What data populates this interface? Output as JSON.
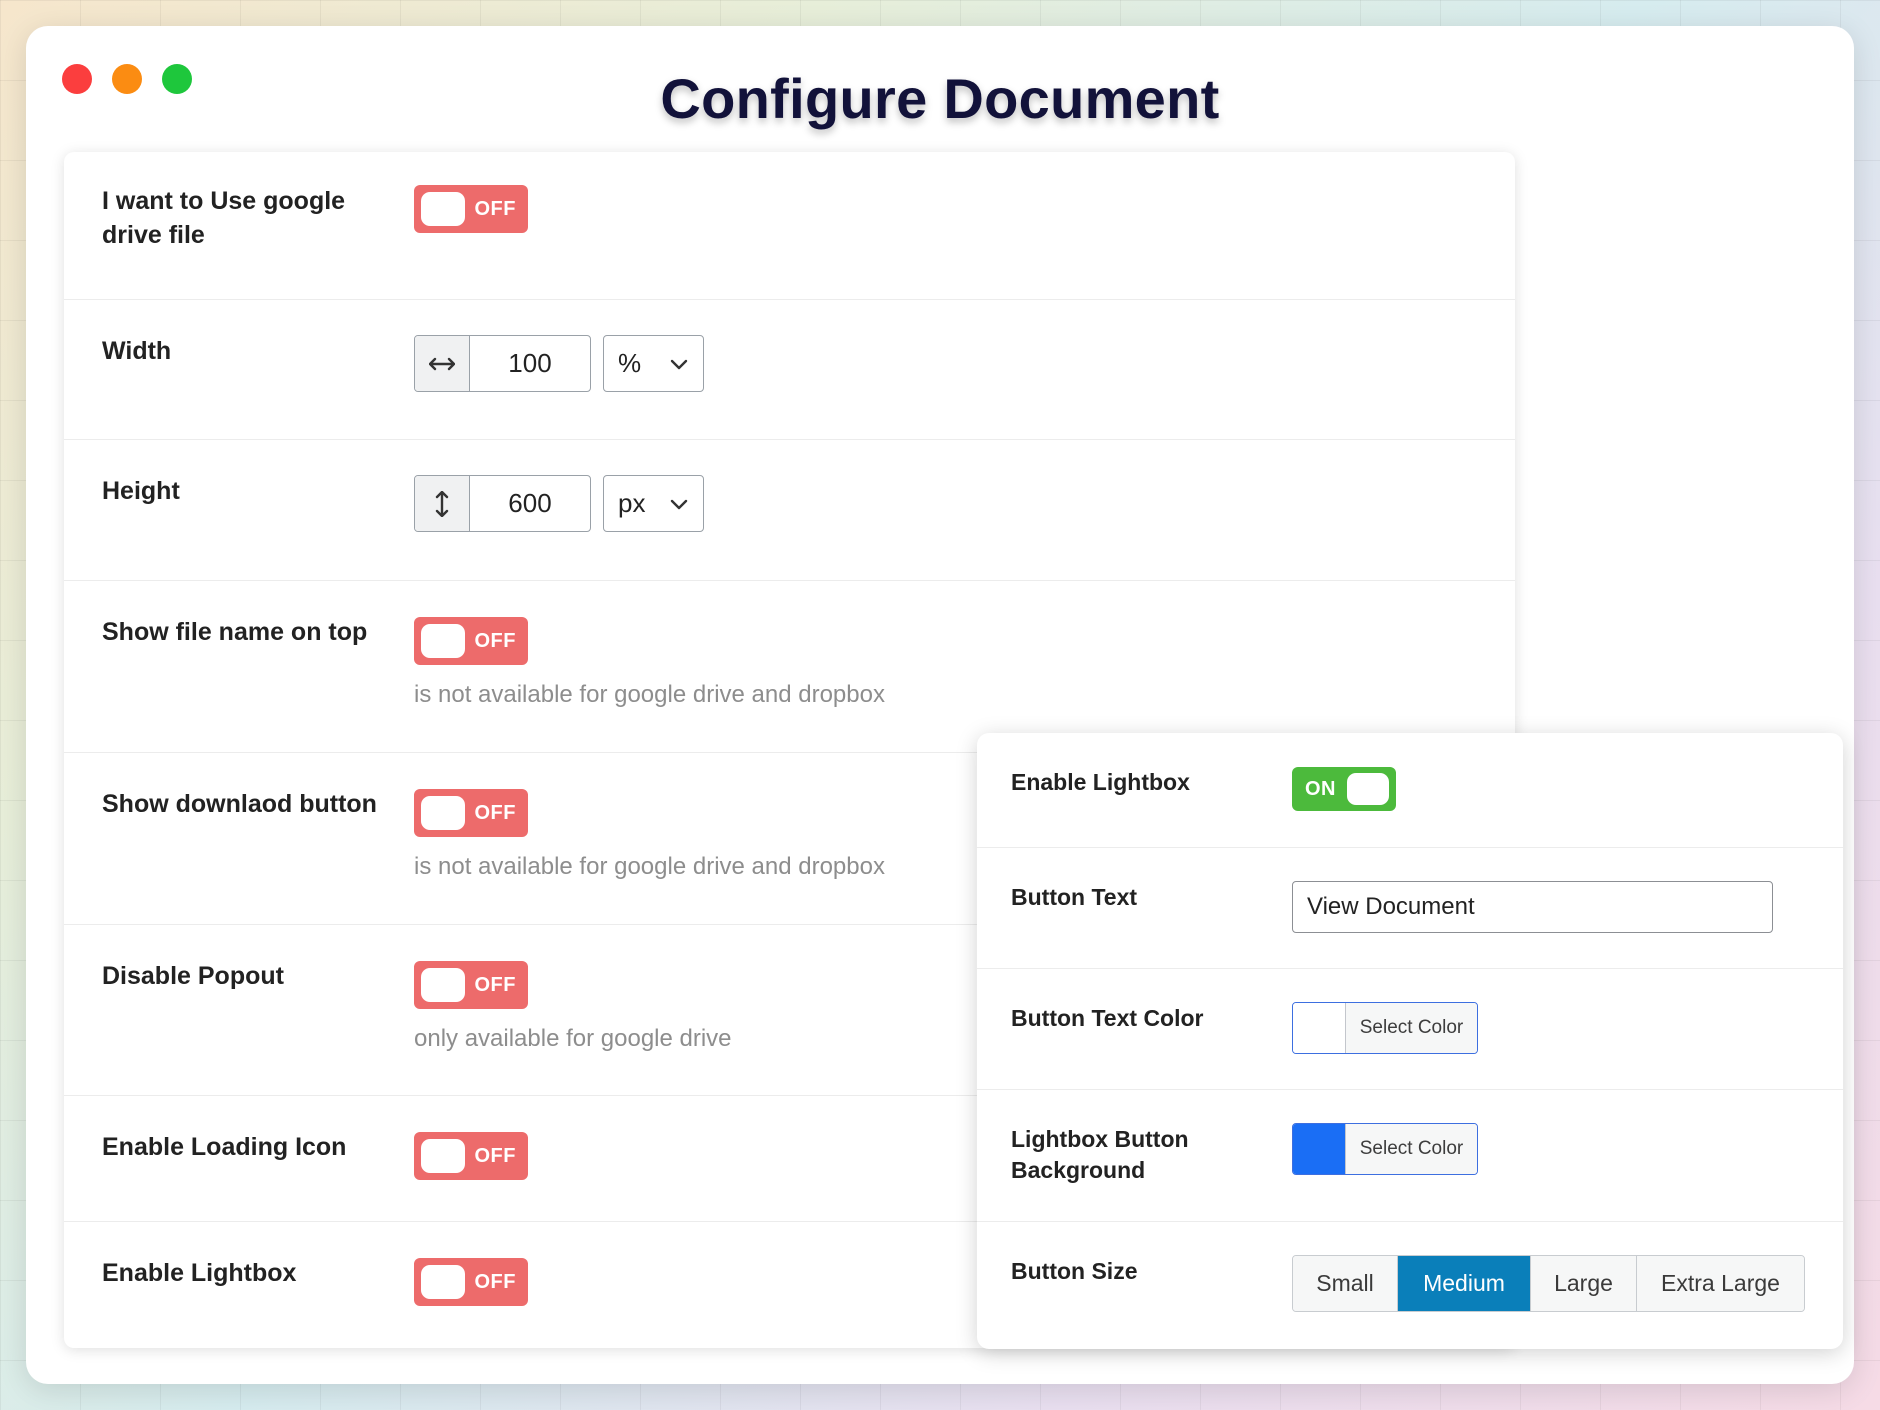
{
  "window": {
    "title": "Configure Document"
  },
  "main": {
    "rows": [
      {
        "label": "I want to Use google drive file",
        "toggle": "OFF"
      },
      {
        "label": "Width",
        "value": "100",
        "unit": "%",
        "icon": "horizontal-resize-icon"
      },
      {
        "label": "Height",
        "value": "600",
        "unit": "px",
        "icon": "vertical-resize-icon"
      },
      {
        "label": "Show file name on top",
        "toggle": "OFF",
        "note": "is not available for google drive and dropbox"
      },
      {
        "label": "Show downlaod button",
        "toggle": "OFF",
        "note": "is not available for google drive and dropbox"
      },
      {
        "label": "Disable Popout",
        "toggle": "OFF",
        "note": "only available for google drive"
      },
      {
        "label": "Enable Loading Icon",
        "toggle": "OFF"
      },
      {
        "label": "Enable Lightbox",
        "toggle": "OFF"
      }
    ]
  },
  "lightbox": {
    "enable_label": "Enable Lightbox",
    "enable_toggle": "ON",
    "button_text_label": "Button Text",
    "button_text_value": "View Document",
    "text_color_label": "Button Text Color",
    "text_color_button": "Select Color",
    "text_color_value": "#ffffff",
    "bg_label": "Lightbox Button Background",
    "bg_button": "Select Color",
    "bg_value": "#1a6ef5",
    "size_label": "Button Size",
    "sizes": [
      "Small",
      "Medium",
      "Large",
      "Extra Large"
    ],
    "selected_size": "Medium"
  },
  "colors": {
    "toggle_off": "#ed6b6b",
    "toggle_on": "#4cba3c",
    "accent": "#0a7fba",
    "title": "#12123a"
  }
}
